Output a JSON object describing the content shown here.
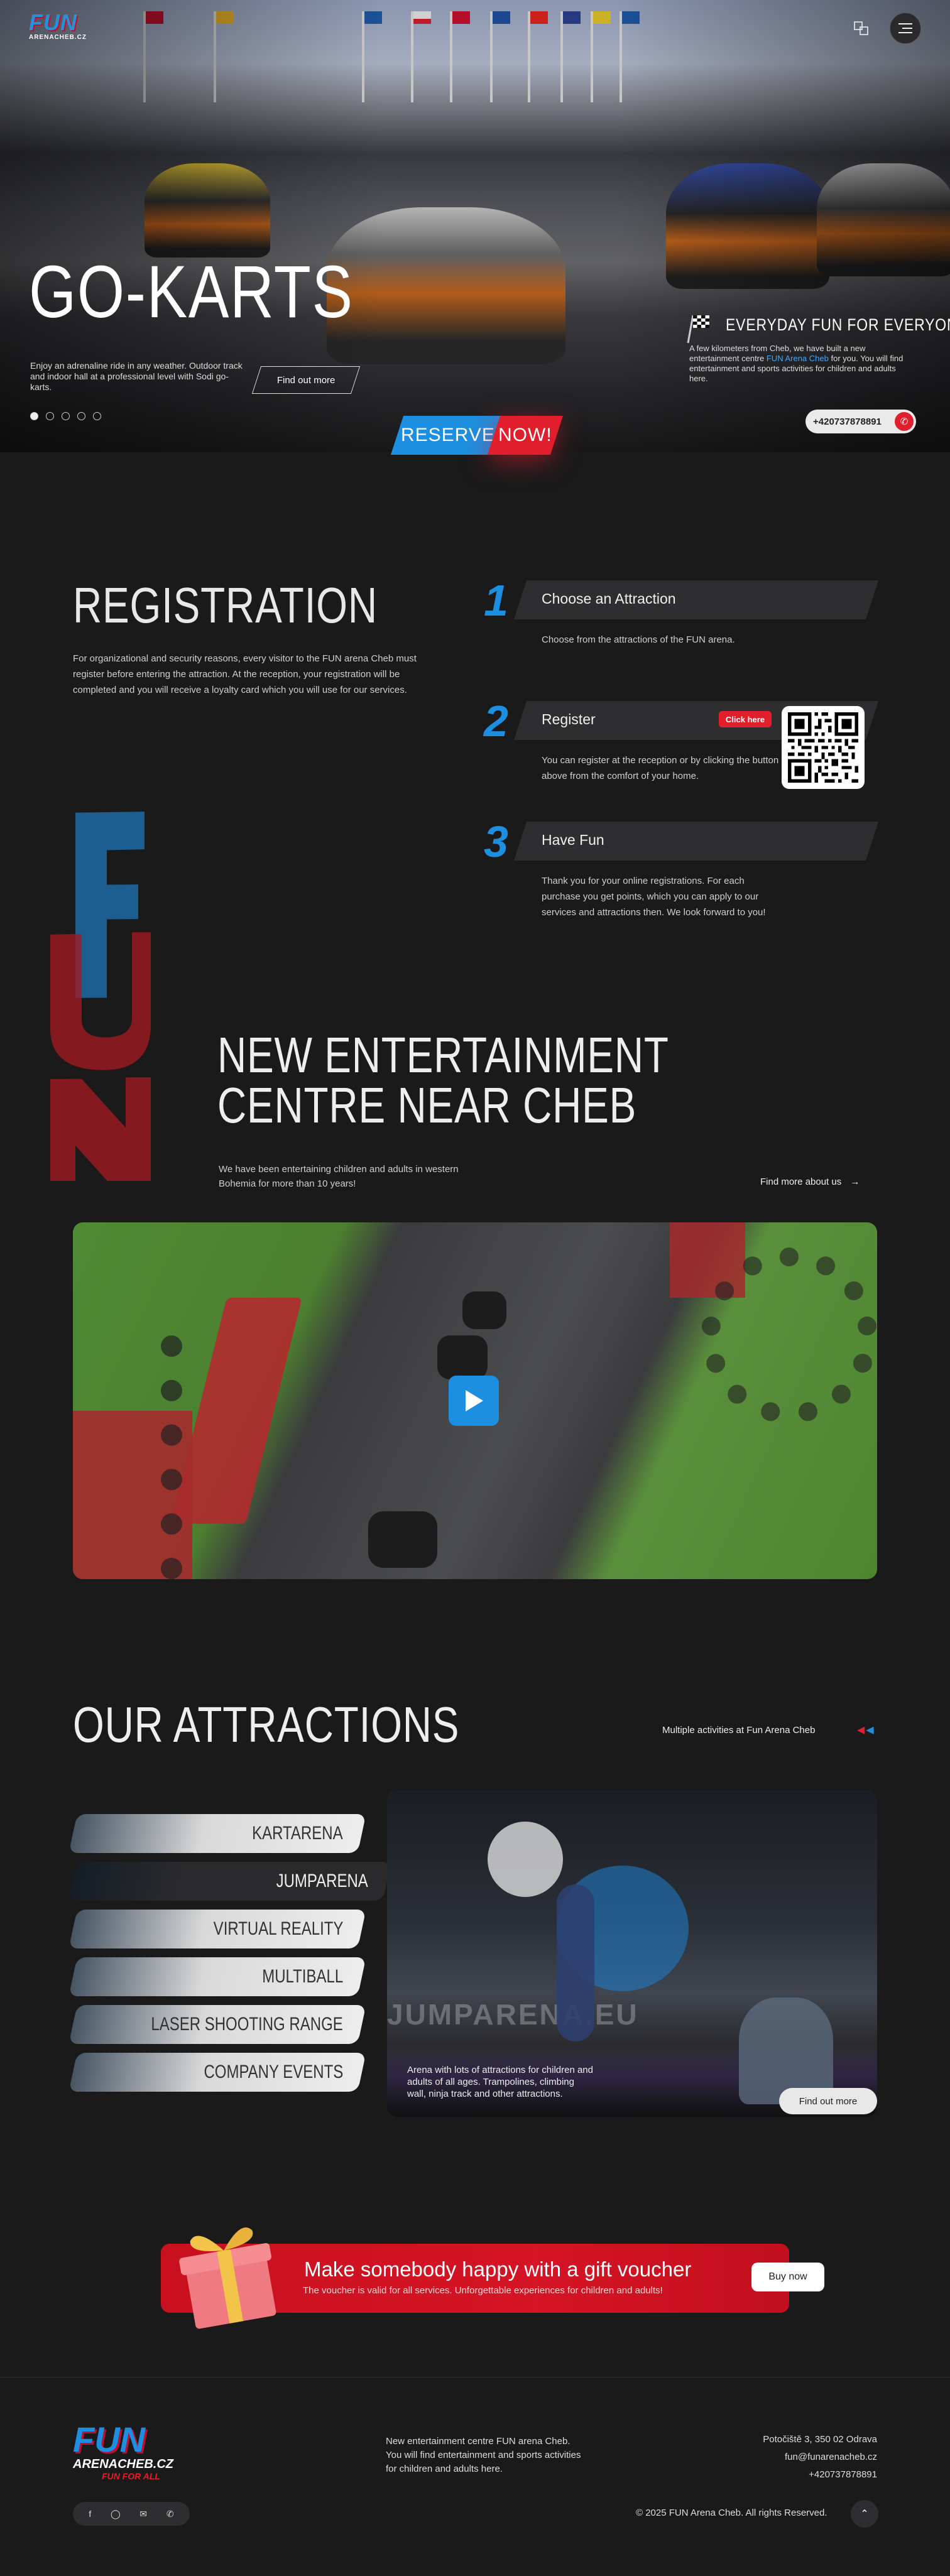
{
  "header": {
    "logo_main": "FUN",
    "logo_sub": "ARENACHEB.CZ",
    "language_icon": "translate-icon",
    "menu_icon": "menu-icon"
  },
  "hero": {
    "title": "GO-KARTS",
    "description": "Enjoy an adrenaline ride in any weather. Outdoor track and indoor hall at a professional level with Sodi go-karts.",
    "cta": "Find out more",
    "slides": 5,
    "active_slide": 1,
    "reserve_label": "RESERVE",
    "now_label": "NOW!",
    "everyday_title": "EVERYDAY FUN FOR EVERYONE",
    "everyday_text_1": "A few kilometers from Cheb, we have built a new entertainment centre ",
    "everyday_text_link": "FUN Arena Cheb",
    "everyday_text_2": " for you. You will find entertainment and sports activities for children and adults here.",
    "phone": "+420737878891"
  },
  "registration": {
    "title": "REGISTRATION",
    "description": "For organizational and security reasons, every visitor to the FUN arena Cheb must register before entering the attraction. At the reception, your registration will be completed and you will receive a loyalty card which you will use for our services.",
    "steps": [
      {
        "num": "1",
        "label": "Choose an Attraction",
        "text": "Choose from the attractions of the FUN arena."
      },
      {
        "num": "2",
        "label": "Register",
        "badge": "Click here",
        "text": "You can register at the reception or by clicking the button above from the comfort of your home."
      },
      {
        "num": "3",
        "label": "Have Fun",
        "text": "Thank you for your online registrations. For each purchase you get points, which you can apply to our services and attractions then. We look forward to you!"
      }
    ]
  },
  "entertainment": {
    "title_line1": "NEW ENTERTAINMENT",
    "title_line2": "CENTRE NEAR CHEB",
    "description": "We have been entertaining children and adults in western Bohemia for more than 10 years!",
    "link": "Find more about us"
  },
  "attractions": {
    "title": "OUR ATTRACTIONS",
    "subtitle": "Multiple activities at Fun Arena Cheb",
    "items": [
      "KARTARENA",
      "JUMPARENA",
      "VIRTUAL REALITY",
      "MULTIBALL",
      "LASER SHOOTING RANGE",
      "COMPANY EVENTS"
    ],
    "active_index": 1,
    "image_caption": "JUMPARENA.EU",
    "active_description": "Arena with lots of attractions for children and adults of all ages. Trampolines, climbing wall, ninja track and other attractions.",
    "button": "Find out more"
  },
  "gift": {
    "title": "Make somebody happy with a gift voucher",
    "text": "The voucher is valid for all services. Unforgettable experiences for children and adults!",
    "button": "Buy now"
  },
  "footer": {
    "logo_main": "FUN",
    "logo_sub": "ARENACHEB.CZ",
    "logo_tag": "FUN FOR ALL",
    "description": "New entertainment centre FUN arena Cheb. You will find entertainment and sports activities for children and adults here.",
    "address": "Potočiště 3, 350 02 Odrava",
    "email": "fun@funarenacheb.cz",
    "phone": "+420737878891",
    "copyright": "© 2025 FUN Arena Cheb. All rights Reserved."
  },
  "colors": {
    "accent_blue": "#1d8fe0",
    "accent_red": "#e01e2c",
    "background": "#1a1a1b"
  }
}
